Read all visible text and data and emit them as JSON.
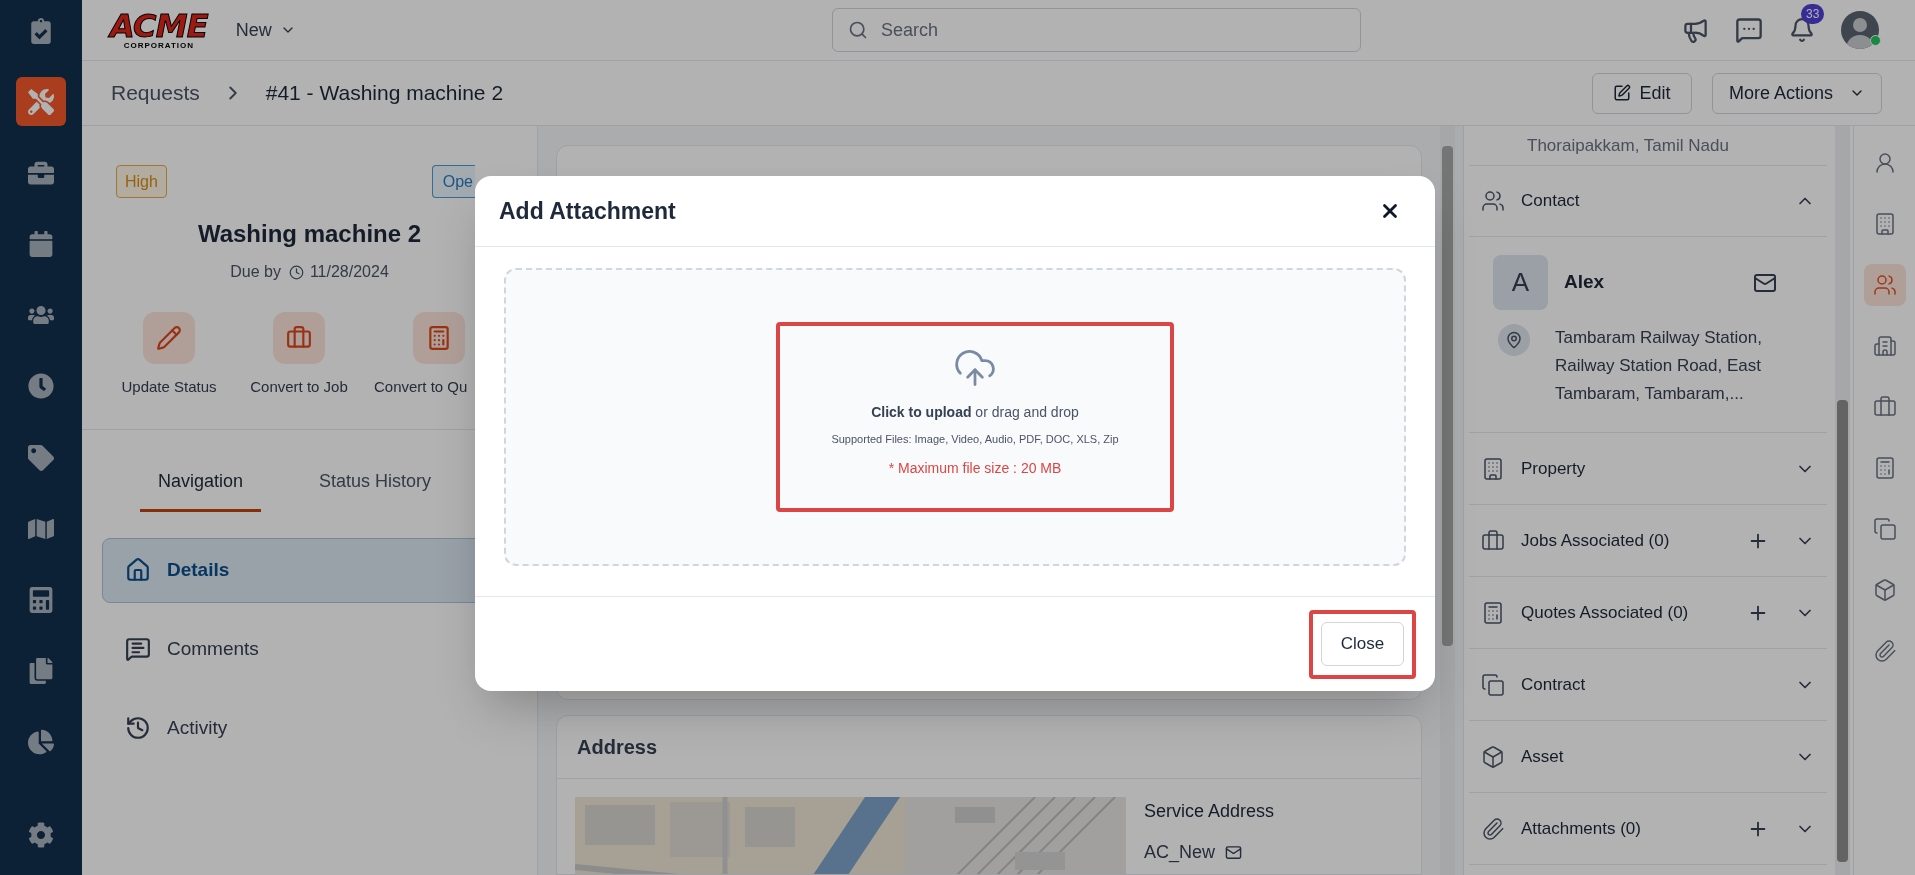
{
  "sidebar": {
    "items": [
      {
        "kind": "checklist",
        "selected": false
      },
      {
        "kind": "tools",
        "selected": true
      },
      {
        "kind": "briefcase",
        "selected": false
      },
      {
        "kind": "calendar",
        "selected": false
      },
      {
        "kind": "users",
        "selected": false
      },
      {
        "kind": "clock",
        "selected": false
      },
      {
        "kind": "tag",
        "selected": false
      },
      {
        "kind": "map",
        "selected": false
      },
      {
        "kind": "calculator",
        "selected": false
      },
      {
        "kind": "files",
        "selected": false
      },
      {
        "kind": "pie",
        "selected": false
      }
    ],
    "footer_item": {
      "kind": "gear",
      "selected": false
    }
  },
  "top_bar": {
    "logo": {
      "title": "ACME",
      "subtitle": "CORPORATION"
    },
    "new_menu": "New",
    "search": {
      "placeholder": "Search"
    },
    "notifications": {
      "count": "33"
    },
    "avatar": {
      "online": true
    }
  },
  "breadcrumb": {
    "items": [
      "Requests",
      "#41 - Washing machine 2"
    ]
  },
  "header_actions": [
    {
      "kind": "edit",
      "label": "Edit"
    },
    {
      "kind": "menu",
      "label": "More Actions"
    }
  ],
  "request": {
    "priority": "High",
    "status": "Ope",
    "title": "Washing machine 2",
    "due_label": "Due by",
    "due_date": "11/28/2024",
    "actions": [
      {
        "kind": "pencil",
        "label": "Update Status"
      },
      {
        "kind": "briefcase",
        "label": "Convert to Job"
      },
      {
        "kind": "calculator",
        "label": "Convert to Qu"
      }
    ]
  },
  "tabs": [
    {
      "label": "Navigation",
      "selected": true
    },
    {
      "label": "Status History",
      "selected": false
    }
  ],
  "nav": [
    {
      "kind": "home",
      "label": "Details",
      "selected": true
    },
    {
      "kind": "comments",
      "label": "Comments",
      "selected": false
    },
    {
      "kind": "history",
      "label": "Activity",
      "selected": false
    }
  ],
  "address_card": {
    "title": "Address",
    "service_address_label": "Service Address",
    "service_address_name": "AC_New"
  },
  "right_panel": {
    "address_tail": "Thoraipakkam, Tamil Nadu",
    "sections": [
      {
        "kind": "users",
        "label": "Contact",
        "expanded": true,
        "addable": false,
        "contacts": [
          {
            "initial": "A",
            "name": "Alex",
            "address": "Tambaram Railway Station, Railway Station Road, East Tambaram, Tambaram,..."
          }
        ]
      },
      {
        "kind": "building",
        "label": "Property",
        "expanded": false,
        "addable": false
      },
      {
        "kind": "briefcase",
        "label": "Jobs Associated (0)",
        "expanded": false,
        "addable": true
      },
      {
        "kind": "calculator",
        "label": "Quotes Associated (0)",
        "expanded": false,
        "addable": true
      },
      {
        "kind": "copy",
        "label": "Contract",
        "expanded": false,
        "addable": false
      },
      {
        "kind": "box",
        "label": "Asset",
        "expanded": false,
        "addable": false
      },
      {
        "kind": "paperclip",
        "label": "Attachments (0)",
        "expanded": false,
        "addable": true
      }
    ]
  },
  "right_rail": [
    {
      "kind": "user",
      "selected": false
    },
    {
      "kind": "building",
      "selected": false
    },
    {
      "kind": "users",
      "selected": true
    },
    {
      "kind": "buildings",
      "selected": false
    },
    {
      "kind": "briefcase",
      "selected": false
    },
    {
      "kind": "calculator",
      "selected": false
    },
    {
      "kind": "copy",
      "selected": false
    },
    {
      "kind": "box",
      "selected": false
    },
    {
      "kind": "paperclip",
      "selected": false
    }
  ],
  "modal": {
    "title": "Add Attachment",
    "upload_text": "**Click to upload** or drag and drop",
    "supported": "Supported Files: Image, Video, Audio, PDF, DOC, XLS, Zip",
    "max_size": "* Maximum file size : 20 MB",
    "highlighted": true,
    "close_button": {
      "label": "Close",
      "highlighted": true
    }
  }
}
